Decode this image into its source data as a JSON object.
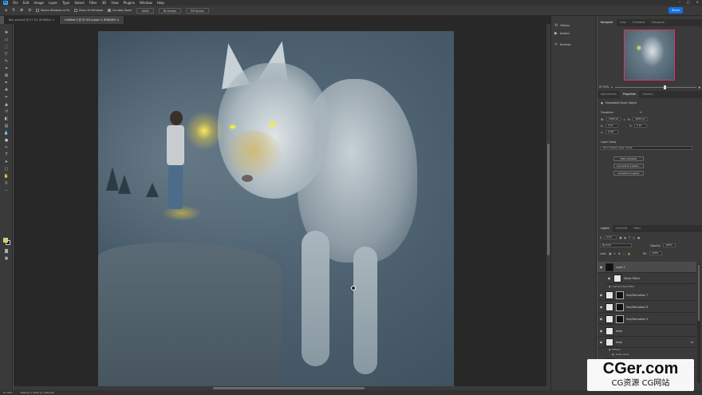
{
  "menubar": {
    "logo": "Ps",
    "items": [
      "File",
      "Edit",
      "Image",
      "Layer",
      "Type",
      "Select",
      "Filter",
      "3D",
      "View",
      "Plugins",
      "Window",
      "Help"
    ],
    "window_controls": [
      "–",
      "□",
      "✕"
    ]
  },
  "options": {
    "resize_windows": "Resize Windows to Fit",
    "zoom_all": "Zoom All Windows",
    "scrubby_zoom": "Scrubby Zoom",
    "zoom_100": "100%",
    "fit_screen": "Fit Screen",
    "fill_screen": "Fill Screen",
    "share": "Share"
  },
  "tabs": [
    {
      "label": "Boy wolf.psd @ 97.4% (RGB/8#) ×"
    },
    {
      "label": "Untitled-1 @ 97.4% (Layer 2, RGB/16*) ×"
    }
  ],
  "dock": {
    "history": "History",
    "actions": "Actions",
    "brushes": "Brushes"
  },
  "navigator": {
    "tabs": [
      "Navigator",
      "Color",
      "Gradients",
      "Histogram"
    ],
    "zoom": "97.35%"
  },
  "properties": {
    "tabs": [
      "Adjustments",
      "Properties",
      "Libraries"
    ],
    "object_type": "Embedded Smart Object",
    "transform_title": "Transform",
    "w_label": "W:",
    "w_value": "2000 px",
    "h_label": "H:",
    "h_value": "2000 px",
    "x_label": "X:",
    "x_value": "0 px",
    "y_label": "Y:",
    "y_value": "0 px",
    "angle_value": "0.00°",
    "layer_comp_label": "Layer Comp",
    "layer_comp_placeholder": "Don't Apply Layer Comp",
    "btn_edit": "Edit Contents",
    "btn_convert_linked": "Convert to Linked...",
    "btn_convert_layers": "Convert to Layers"
  },
  "layers_panel": {
    "tabs": [
      "Layers",
      "Channels",
      "Paths"
    ],
    "kind": "Kind",
    "blend": "Normal",
    "opacity_label": "Opacity:",
    "opacity_value": "100%",
    "lock_label": "Lock:",
    "fill_label": "Fill:",
    "fill_value": "100%",
    "rows": [
      {
        "name": "Layer 2",
        "thumb": "dark",
        "selected": true
      },
      {
        "name": "Smart Filters",
        "thumb": "light",
        "selected": false
      },
      {
        "name": "Hue/Saturation 7",
        "thumb": "mask",
        "selected": false
      },
      {
        "name": "Hue/Saturation 6",
        "thumb": "mask",
        "selected": false
      },
      {
        "name": "Hue/Saturation 5",
        "thumb": "mask",
        "selected": false
      },
      {
        "name": "lamp",
        "thumb": "light",
        "selected": false
      },
      {
        "name": "lamp",
        "thumb": "light",
        "selected": false
      },
      {
        "name": "Fog",
        "thumb": "light",
        "selected": false
      },
      {
        "name": "Levels 1",
        "thumb": "light",
        "selected": false
      }
    ],
    "subs": {
      "camera_raw": "Camera Raw Filter",
      "effects": "Effects",
      "outer_glow": "Outer Glow"
    }
  },
  "status": {
    "zoom": "97.35%",
    "doc": "2000 px x 2000 px (300 ppi)"
  },
  "watermark": {
    "line1": "CGer.com",
    "line2": "CG资源 CG网站"
  },
  "colors": {
    "foreground": "#e9d21a",
    "background": "#1a1a1a",
    "accent": "#1473e6",
    "navigator_frame": "#e0335a"
  }
}
